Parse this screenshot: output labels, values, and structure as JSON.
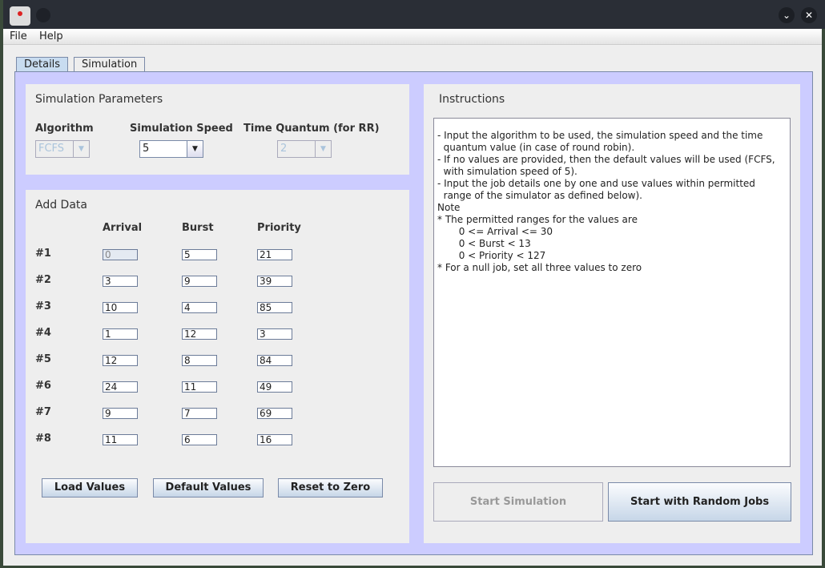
{
  "window": {
    "title": ""
  },
  "menu": [
    "File",
    "Help"
  ],
  "tabs": [
    "Details",
    "Simulation"
  ],
  "params": {
    "title": "Simulation Parameters",
    "algorithm_label": "Algorithm",
    "algorithm_value": "FCFS",
    "speed_label": "Simulation Speed",
    "speed_value": "5",
    "quantum_label": "Time Quantum (for RR)",
    "quantum_value": "2"
  },
  "add_data": {
    "title": "Add Data",
    "columns": [
      "Arrival",
      "Burst",
      "Priority"
    ],
    "rows": [
      {
        "label": "#1",
        "arrival": "0",
        "burst": "5",
        "priority": "21"
      },
      {
        "label": "#2",
        "arrival": "3",
        "burst": "9",
        "priority": "39"
      },
      {
        "label": "#3",
        "arrival": "10",
        "burst": "4",
        "priority": "85"
      },
      {
        "label": "#4",
        "arrival": "1",
        "burst": "12",
        "priority": "3"
      },
      {
        "label": "#5",
        "arrival": "12",
        "burst": "8",
        "priority": "84"
      },
      {
        "label": "#6",
        "arrival": "24",
        "burst": "11",
        "priority": "49"
      },
      {
        "label": "#7",
        "arrival": "9",
        "burst": "7",
        "priority": "69"
      },
      {
        "label": "#8",
        "arrival": "11",
        "burst": "6",
        "priority": "16"
      }
    ],
    "buttons": [
      "Load Values",
      "Default Values",
      "Reset to Zero"
    ]
  },
  "instructions": {
    "title": "Instructions",
    "text": "- Input the algorithm to be used, the simulation speed and the time\n  quantum value (in case of round robin).\n- If no values are provided, then the default values will be used (FCFS,\n  with simulation speed of 5).\n- Input the job details one by one and use values within permitted\n  range of the simulator as defined below).\nNote\n* The permitted ranges for the values are\n       0 <= Arrival <= 30\n       0 < Burst < 13\n       0 < Priority < 127\n* For a null job, set all three values to zero"
  },
  "actions": {
    "start": "Start Simulation",
    "random": "Start with Random Jobs"
  }
}
